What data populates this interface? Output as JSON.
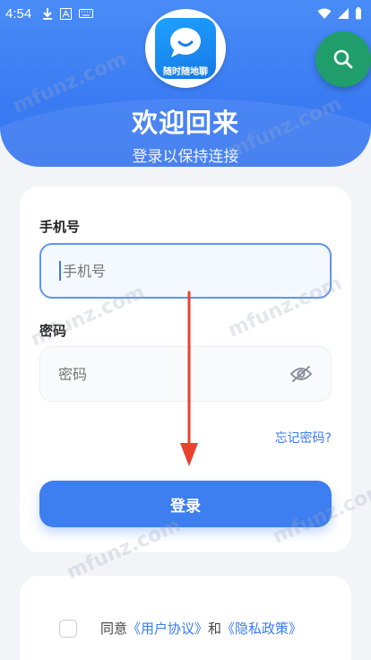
{
  "status_bar": {
    "time": "4:54"
  },
  "header": {
    "logo_text": "随时随地聊",
    "title": "欢迎回来",
    "subtitle": "登录以保持连接"
  },
  "form": {
    "phone_label": "手机号",
    "phone_placeholder": "手机号",
    "password_label": "密码",
    "password_placeholder": "密码",
    "forgot_password": "忘记密码?",
    "login_button": "登录"
  },
  "agreement": {
    "prefix": "同意",
    "user_agreement": "《用户协议》",
    "and": "和",
    "privacy_policy": "《隐私政策》"
  },
  "watermark": "mfunz.com",
  "colors": {
    "primary": "#3d7ef0",
    "fab": "#1f9e6c",
    "annotation_arrow": "#e8412e"
  }
}
